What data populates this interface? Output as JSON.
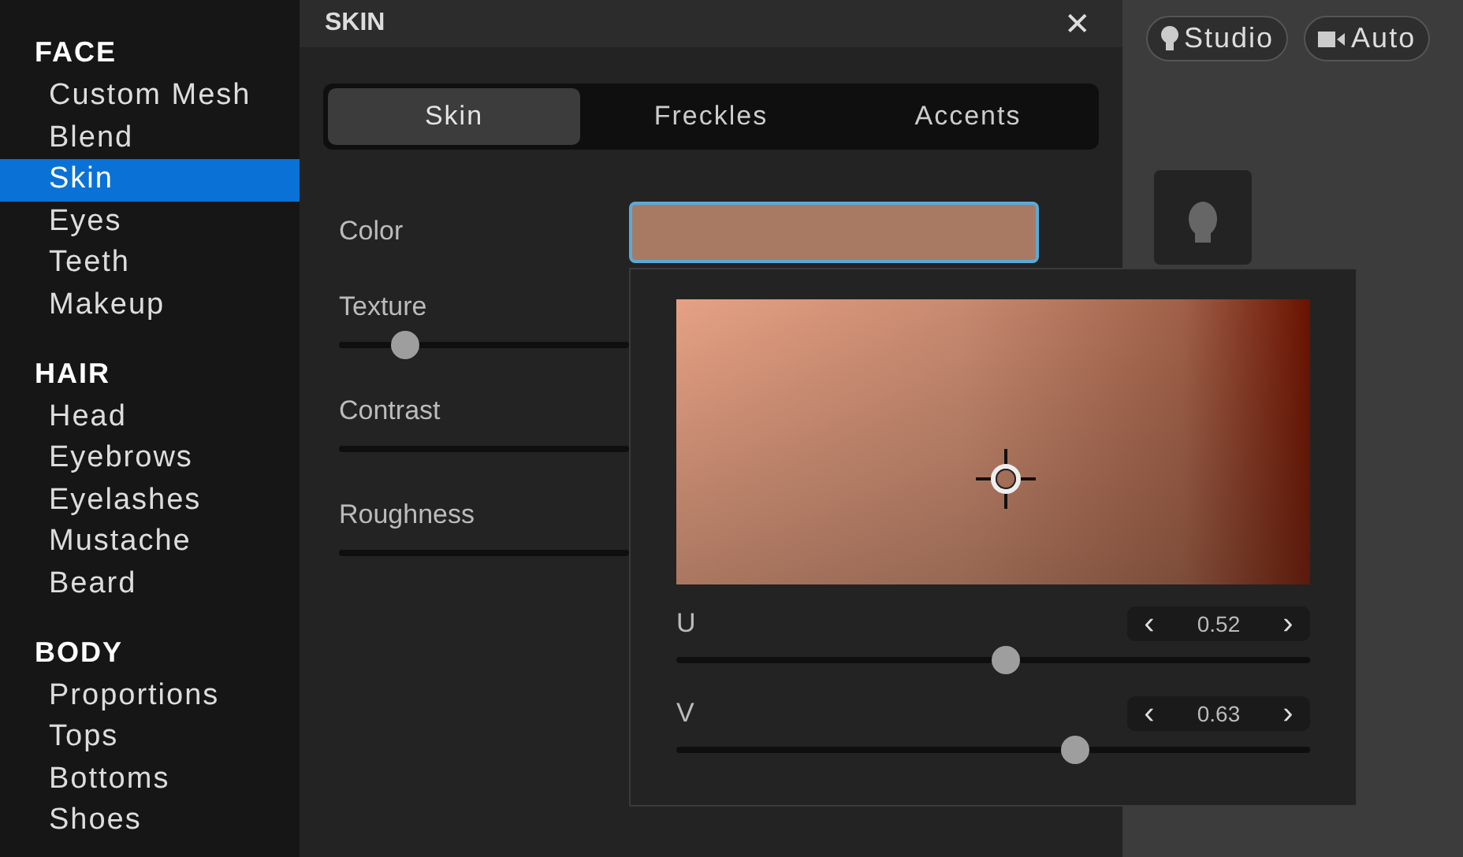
{
  "sidebar": {
    "sections": [
      {
        "title": "FACE",
        "items": [
          {
            "label": "Custom Mesh",
            "selected": false
          },
          {
            "label": "Blend",
            "selected": false
          },
          {
            "label": "Skin",
            "selected": true
          },
          {
            "label": "Eyes",
            "selected": false
          },
          {
            "label": "Teeth",
            "selected": false
          },
          {
            "label": "Makeup",
            "selected": false
          }
        ]
      },
      {
        "title": "HAIR",
        "items": [
          {
            "label": "Head",
            "selected": false
          },
          {
            "label": "Eyebrows",
            "selected": false
          },
          {
            "label": "Eyelashes",
            "selected": false
          },
          {
            "label": "Mustache",
            "selected": false
          },
          {
            "label": "Beard",
            "selected": false
          }
        ]
      },
      {
        "title": "BODY",
        "items": [
          {
            "label": "Proportions",
            "selected": false
          },
          {
            "label": "Tops",
            "selected": false
          },
          {
            "label": "Bottoms",
            "selected": false
          },
          {
            "label": "Shoes",
            "selected": false
          }
        ]
      }
    ]
  },
  "panel": {
    "title": "SKIN",
    "close": "✕",
    "tabs": [
      {
        "label": "Skin",
        "selected": true
      },
      {
        "label": "Freckles",
        "selected": false
      },
      {
        "label": "Accents",
        "selected": false
      }
    ],
    "properties": [
      {
        "kind": "color",
        "label": "Color"
      },
      {
        "kind": "slider",
        "label": "Texture",
        "level": 0.23
      },
      {
        "kind": "track",
        "label": "Contrast"
      },
      {
        "kind": "track",
        "label": "Roughness"
      }
    ]
  },
  "picker": {
    "sliders": [
      {
        "label": "U",
        "value": "0.52",
        "level": 0.52,
        "prev": "‹",
        "next": "›"
      },
      {
        "label": "V",
        "value": "0.63",
        "level": 0.63,
        "prev": "‹",
        "next": "›"
      }
    ]
  },
  "viewport": {
    "buttons": [
      {
        "kind": "light",
        "label": "Studio"
      },
      {
        "kind": "camera",
        "label": "Auto"
      }
    ]
  }
}
